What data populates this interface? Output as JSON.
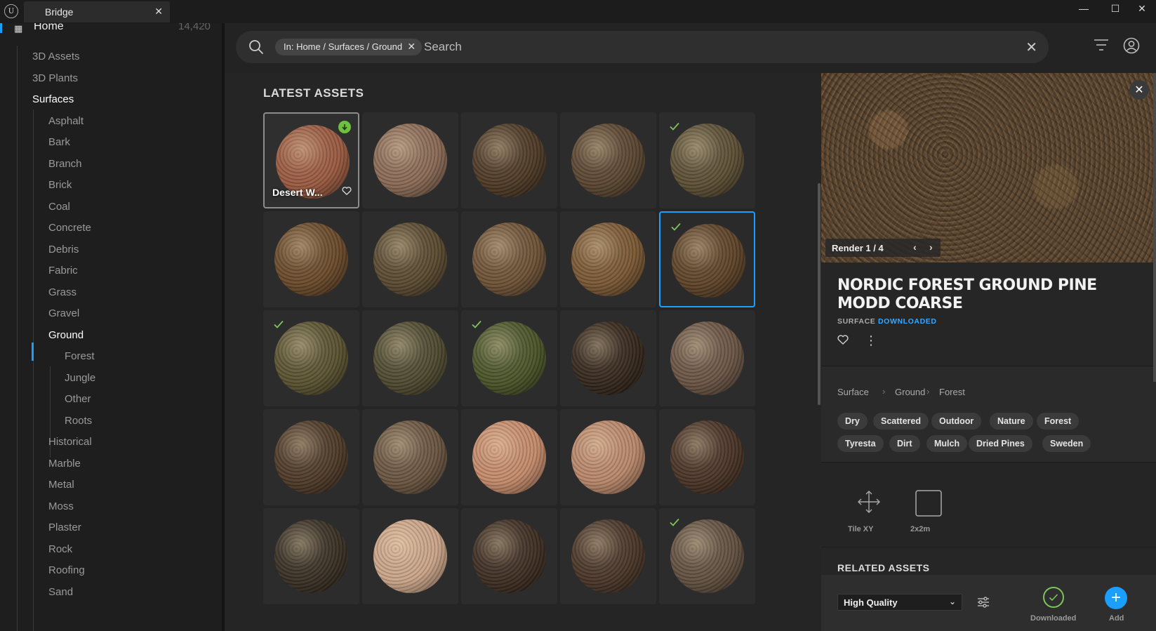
{
  "window": {
    "tab_title": "Bridge",
    "logo_glyph": "U",
    "tab_close": "✕",
    "min": "—",
    "max": "☐",
    "close": "✕"
  },
  "sidebar": {
    "home_label": "Home",
    "home_count": "14,420",
    "home_icon": "grid-icon",
    "items": [
      {
        "label": "3D Assets"
      },
      {
        "label": "3D Plants"
      },
      {
        "label": "Surfaces"
      },
      {
        "label": "Asphalt"
      },
      {
        "label": "Bark"
      },
      {
        "label": "Branch"
      },
      {
        "label": "Brick"
      },
      {
        "label": "Coal"
      },
      {
        "label": "Concrete"
      },
      {
        "label": "Debris"
      },
      {
        "label": "Fabric"
      },
      {
        "label": "Grass"
      },
      {
        "label": "Gravel"
      },
      {
        "label": "Ground"
      },
      {
        "label": "Forest"
      },
      {
        "label": "Jungle"
      },
      {
        "label": "Other"
      },
      {
        "label": "Roots"
      },
      {
        "label": "Historical"
      },
      {
        "label": "Marble"
      },
      {
        "label": "Metal"
      },
      {
        "label": "Moss"
      },
      {
        "label": "Plaster"
      },
      {
        "label": "Rock"
      },
      {
        "label": "Roofing"
      },
      {
        "label": "Sand"
      }
    ]
  },
  "search": {
    "chip": "In: Home / Surfaces / Ground",
    "chip_close": "✕",
    "placeholder": "Search",
    "clear": "✕"
  },
  "grid": {
    "section_title": "LATEST ASSETS",
    "first_name": "Desert W...",
    "tiles": [
      {
        "color": "#9a5a40",
        "state": "download"
      },
      {
        "color": "#8a6a55",
        "state": ""
      },
      {
        "color": "#4e3a26",
        "state": ""
      },
      {
        "color": "#5a4630",
        "state": ""
      },
      {
        "color": "#5c4f35",
        "state": "check"
      },
      {
        "color": "#6a4a2a",
        "state": ""
      },
      {
        "color": "#5a4a30",
        "state": ""
      },
      {
        "color": "#6e5236",
        "state": ""
      },
      {
        "color": "#7a5834",
        "state": ""
      },
      {
        "color": "#5e4328",
        "state": "check-selected"
      },
      {
        "color": "#5a5230",
        "state": "check"
      },
      {
        "color": "#4f4a30",
        "state": ""
      },
      {
        "color": "#4a5428",
        "state": "check"
      },
      {
        "color": "#36281c",
        "state": ""
      },
      {
        "color": "#6a5444",
        "state": ""
      },
      {
        "color": "#4e3a28",
        "state": ""
      },
      {
        "color": "#6a5540",
        "state": ""
      },
      {
        "color": "#c48a6a",
        "state": ""
      },
      {
        "color": "#b8876a",
        "state": ""
      },
      {
        "color": "#4a3426",
        "state": ""
      },
      {
        "color": "#3a3024",
        "state": ""
      },
      {
        "color": "#caa488",
        "state": ""
      },
      {
        "color": "#3e2e22",
        "state": ""
      },
      {
        "color": "#4a3628",
        "state": ""
      },
      {
        "color": "#625040",
        "state": "check"
      }
    ]
  },
  "detail": {
    "close": "✕",
    "render_label": "Render 1 / 4",
    "render_prev": "‹",
    "render_next": "›",
    "title": "NORDIC FOREST GROUND PINE MODD COARSE",
    "type": "SURFACE",
    "status": "DOWNLOADED",
    "more": "⋮",
    "breadcrumb": [
      "Surface",
      "Ground",
      "Forest"
    ],
    "crumb_sep": "›",
    "tags": [
      "Dry",
      "Scattered",
      "Outdoor",
      "Nature",
      "Forest",
      "Tyresta",
      "Dirt",
      "Mulch",
      "Dried Pines",
      "Sweden"
    ],
    "props": [
      {
        "label": "Tile XY",
        "icon": "move-arrows-icon"
      },
      {
        "label": "2x2m",
        "icon": "square-icon"
      }
    ],
    "related_title": "RELATED ASSETS"
  },
  "actions": {
    "quality": "High Quality",
    "chevron": "⌄",
    "downloaded_label": "Downloaded",
    "add_label": "Add",
    "add_glyph": "+"
  },
  "colors": {
    "accent": "#1a9fff",
    "downloaded": "#7dc55a"
  }
}
